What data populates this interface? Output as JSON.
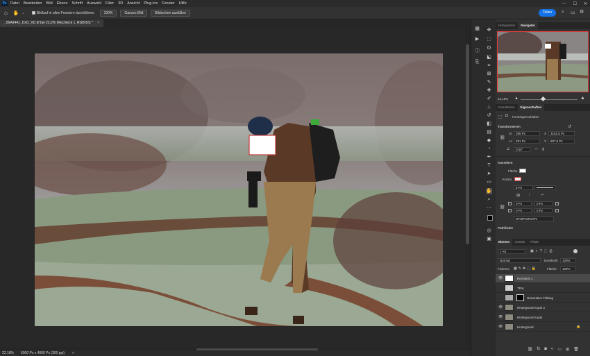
{
  "app": {
    "logo": "Ps",
    "menu": [
      "Datei",
      "Bearbeiten",
      "Bild",
      "Ebene",
      "Schrift",
      "Auswahl",
      "Filter",
      "3D",
      "Ansicht",
      "Plug-ins",
      "Fenster",
      "Hilfe"
    ],
    "window_controls": {
      "minimize": "—",
      "maximize": "☐",
      "close": "✕"
    }
  },
  "options": {
    "scroll_all_label": "Bildlauf in allen Fenstern durchführen",
    "zoom_100": "100%",
    "fit_screen": "Ganzes Bild",
    "fill_screen": "Bildschirm ausfüllen",
    "share": "Teilen"
  },
  "document": {
    "tab_title": "_56A9441_DxO_XD.tif bei 22,2% (Rechteck 1, RGB/16) *",
    "close": "×"
  },
  "status": {
    "zoom": "22.18%",
    "info": "6000 Px x 4000 Px (300 ppi)",
    "arrow": ">"
  },
  "navigator": {
    "tabs": [
      "Histogramm",
      "Navigator"
    ],
    "zoom": "22,18%"
  },
  "properties": {
    "tabs": [
      "Korrekturen",
      "Eigenschaften"
    ],
    "title": "Formeigenschaften",
    "transform": {
      "header": "Transformieren",
      "w_label": "B",
      "w": "395 Px",
      "x_label": "X",
      "x": "3152,5 Px",
      "h_label": "H",
      "h": "281 Px",
      "y_label": "Y",
      "y": "807,5 Px",
      "angle": "0,00°"
    },
    "appearance": {
      "header": "Aussehen",
      "fill_label": "Fläche",
      "stroke_label": "Kontur",
      "stroke_width": "5 Px",
      "corner_values": [
        "0 Px",
        "0 Px",
        "0 Px",
        "0 Px"
      ],
      "corners_text": "0Px0Px0Px0Px"
    },
    "pathfinder": "Pathfinder"
  },
  "layers_panel": {
    "tabs": [
      "Ebenen",
      "Kanäle",
      "Pfade"
    ],
    "kind_label": "Art",
    "blend_mode": "Normal",
    "opacity_label": "Deckkraft:",
    "opacity": "100%",
    "lock_label": "Fixieren:",
    "fill_label": "Fläche:",
    "fill": "100%",
    "layers": [
      {
        "name": "Rechteck 1",
        "visible": true
      },
      {
        "name": "TPAI",
        "visible": false
      },
      {
        "name": "Generative Füllung",
        "visible": false
      },
      {
        "name": "Hintergrund Kopie 2",
        "visible": true
      },
      {
        "name": "Hintergrund Kopie",
        "visible": true
      },
      {
        "name": "Hintergrund",
        "visible": true
      }
    ]
  },
  "colors": {
    "accent": "#1473e6",
    "panel": "#323232",
    "canvas_bg": "#282828",
    "stroke_swatch": "#d23a3a"
  }
}
